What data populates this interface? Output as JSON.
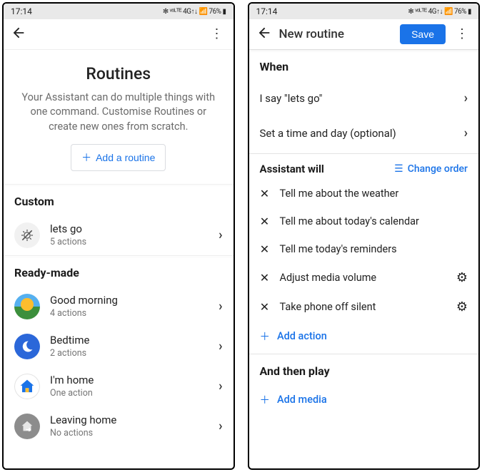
{
  "status": {
    "time": "17:14",
    "right": "✻ ᵛᵒᴸᵀᴱ 4G↑↓ 📶 76% ▮"
  },
  "left": {
    "title": "Routines",
    "desc": "Your Assistant can do multiple things with one command. Customise Routines or create new ones from scratch.",
    "add_btn": "Add a routine",
    "custom_header": "Custom",
    "ready_header": "Ready-made",
    "custom": {
      "name": "lets go",
      "sub": "5 actions"
    },
    "ready": [
      {
        "name": "Good morning",
        "sub": "4 actions"
      },
      {
        "name": "Bedtime",
        "sub": "2 actions"
      },
      {
        "name": "I'm home",
        "sub": "One action"
      },
      {
        "name": "Leaving home",
        "sub": "No actions"
      }
    ]
  },
  "right": {
    "header_title": "New routine",
    "save": "Save",
    "when": "When",
    "say": "I say \"lets go\"",
    "set_time": "Set a time and day (optional)",
    "assistant_will": "Assistant will",
    "change_order": "Change order",
    "actions": [
      {
        "label": "Tell me about the weather",
        "gear": false
      },
      {
        "label": "Tell me about today's calendar",
        "gear": false
      },
      {
        "label": "Tell me today's reminders",
        "gear": false
      },
      {
        "label": "Adjust media volume",
        "gear": true
      },
      {
        "label": "Take phone off silent",
        "gear": true
      }
    ],
    "add_action": "Add action",
    "and_then": "And then play",
    "add_media": "Add media"
  }
}
